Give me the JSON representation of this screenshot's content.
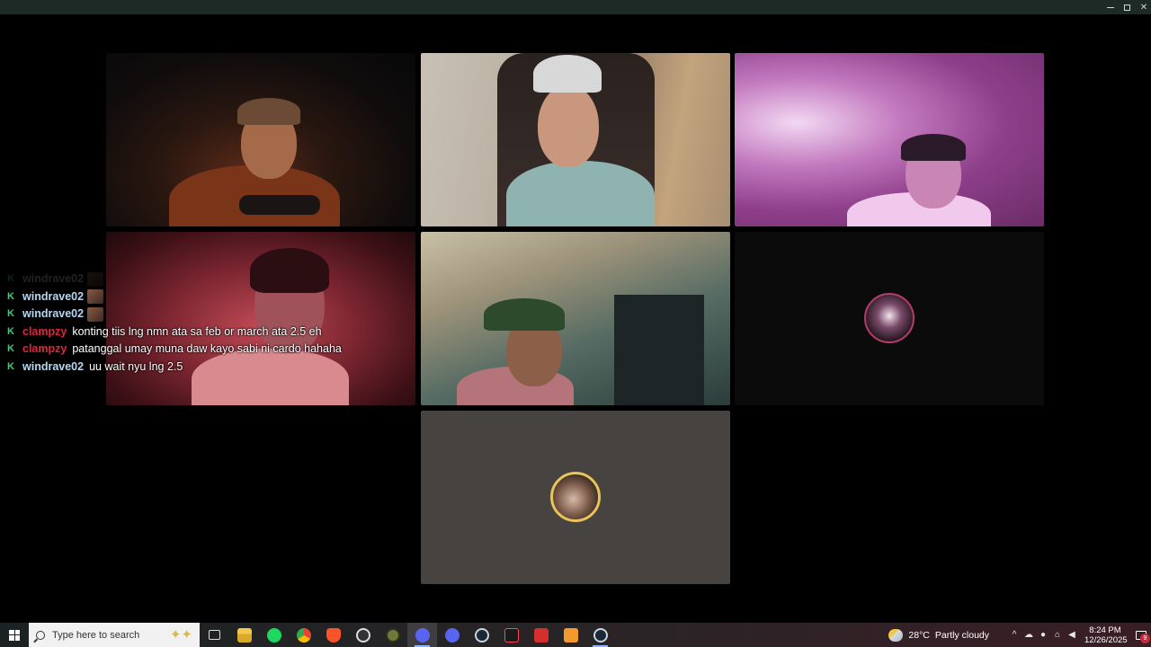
{
  "window": {
    "controls": {
      "minimize": "minimize",
      "maximize": "maximize",
      "close": "close"
    }
  },
  "chat": {
    "messages": [
      {
        "user": "windrave02",
        "text": "",
        "user_color": "#b7b7b7",
        "emote": true,
        "faded": true
      },
      {
        "user": "windrave02",
        "text": "",
        "user_color": "#b7d8f2",
        "emote": true,
        "faded": false
      },
      {
        "user": "windrave02",
        "text": "",
        "user_color": "#b7d8f2",
        "emote": true,
        "faded": false
      },
      {
        "user": "clampzy",
        "text": "konting tiis lng nmn ata sa feb or march ata 2.5 eh",
        "user_color": "#e0263c",
        "emote": false,
        "faded": false
      },
      {
        "user": "clampzy",
        "text": "patanggal umay muna daw kayo sabi ni cardo hahaha",
        "user_color": "#e0263c",
        "emote": false,
        "faded": false
      },
      {
        "user": "windrave02",
        "text": "uu wait nyu lng 2.5",
        "user_color": "#b7d8f2",
        "emote": false,
        "faded": false
      }
    ],
    "badge_color": "#3bd16f"
  },
  "taskbar": {
    "search_placeholder": "Type here to search",
    "apps": [
      "task-view",
      "file-explorer",
      "spotify",
      "chrome",
      "brave",
      "app-circle",
      "app-green",
      "discord-active",
      "discord",
      "steam",
      "valorant",
      "app-red",
      "app-orange",
      "steam-2"
    ],
    "weather_temp": "28°C",
    "weather_text": "Partly cloudy",
    "time": "8:24 PM",
    "date": "12/26/2025",
    "notification_count": "9"
  },
  "colors": {
    "titlebar": "#1d2a26",
    "taskbar_accent": "#8fb4ff",
    "empty_tile": "#474340"
  }
}
